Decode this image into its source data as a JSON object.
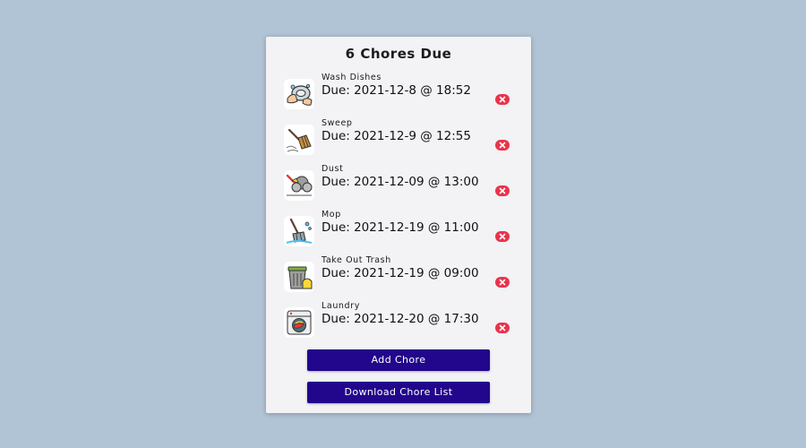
{
  "header": {
    "title": "6 Chores Due"
  },
  "chores": [
    {
      "name": "Wash Dishes",
      "due": "Due: 2021-12-8 @ 18:52",
      "icon": "wash-dishes-icon"
    },
    {
      "name": "Sweep",
      "due": "Due: 2021-12-9 @ 12:55",
      "icon": "broom-icon"
    },
    {
      "name": "Dust",
      "due": "Due: 2021-12-09 @ 13:00",
      "icon": "dust-icon"
    },
    {
      "name": "Mop",
      "due": "Due: 2021-12-19 @ 11:00",
      "icon": "mop-icon"
    },
    {
      "name": "Take Out Trash",
      "due": "Due: 2021-12-19 @ 09:00",
      "icon": "trash-bin-icon"
    },
    {
      "name": "Laundry",
      "due": "Due: 2021-12-20 @ 17:30",
      "icon": "washing-machine-icon"
    }
  ],
  "actions": {
    "add_label": "Add Chore",
    "download_label": "Download Chore List"
  },
  "colors": {
    "background": "#b1c4d5",
    "card": "#f3f2f4",
    "button": "#22068c",
    "delete": "#e8344c"
  }
}
